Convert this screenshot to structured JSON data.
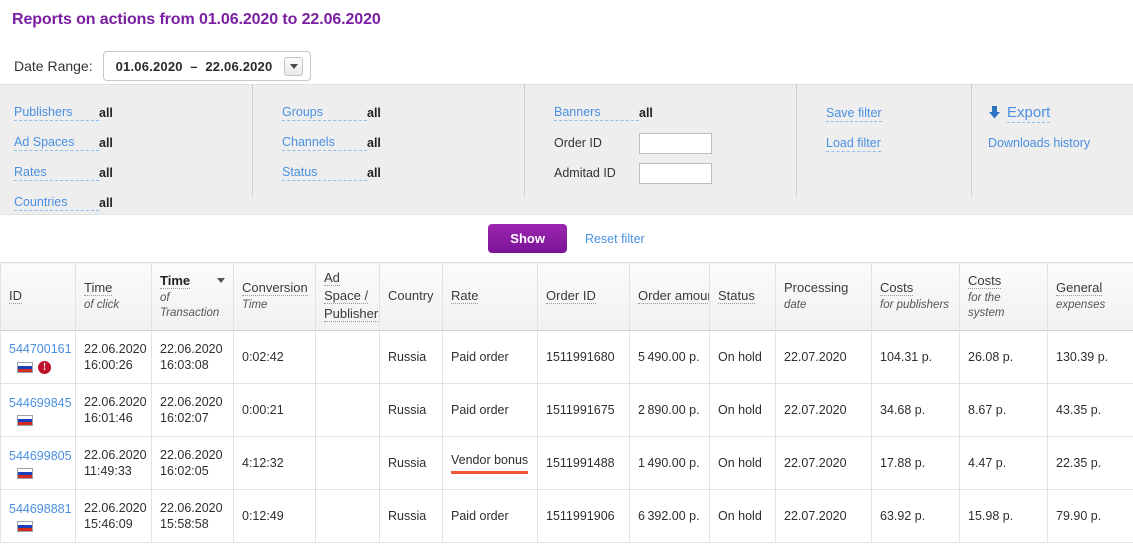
{
  "page": {
    "title": "Reports on actions from 01.06.2020 to 22.06.2020"
  },
  "date_range": {
    "label": "Date Range:",
    "value": "01.06.2020  –  22.06.2020",
    "dropdown_icon": "chevron-down-icon"
  },
  "filters": {
    "col1": [
      {
        "label": "Publishers",
        "value": "all"
      },
      {
        "label": "Ad Spaces",
        "value": "all"
      },
      {
        "label": "Rates",
        "value": "all"
      },
      {
        "label": "Countries",
        "value": "all"
      }
    ],
    "col2": [
      {
        "label": "Groups",
        "value": "all"
      },
      {
        "label": "Channels",
        "value": "all"
      },
      {
        "label": "Status",
        "value": "all"
      }
    ],
    "col3": [
      {
        "label": "Banners",
        "value": "all"
      }
    ],
    "inputs": [
      {
        "label": "Order ID",
        "value": "",
        "placeholder": ""
      },
      {
        "label": "Admitad ID",
        "value": "",
        "placeholder": ""
      }
    ],
    "actions": [
      {
        "label": "Save filter"
      },
      {
        "label": "Load filter"
      }
    ],
    "export": {
      "label": "Export",
      "icon": "download-arrow-icon",
      "history_label": "Downloads history"
    }
  },
  "action_bar": {
    "show_label": "Show",
    "reset_label": "Reset filter"
  },
  "table": {
    "columns": [
      {
        "main": "ID",
        "sub": "",
        "sorted": false,
        "caret": false
      },
      {
        "main": "Time",
        "sub": "of click",
        "sorted": false,
        "caret": false
      },
      {
        "main": "Time",
        "sub": "of Transaction",
        "sorted": true,
        "caret": true
      },
      {
        "main": "Conversion",
        "sub": "Time",
        "sorted": false,
        "caret": false
      },
      {
        "main": "Ad Space / Publisher",
        "sub": "",
        "sorted": false,
        "caret": false
      },
      {
        "main": "Country",
        "sub": "",
        "sorted": false,
        "caret": false
      },
      {
        "main": "Rate",
        "sub": "",
        "sorted": false,
        "caret": false
      },
      {
        "main": "Order ID",
        "sub": "",
        "sorted": false,
        "caret": false
      },
      {
        "main": "Order amount",
        "sub": "",
        "sorted": false,
        "caret": false
      },
      {
        "main": "Status",
        "sub": "",
        "sorted": false,
        "caret": false
      },
      {
        "main": "Processing",
        "sub": "date",
        "sorted": false,
        "caret": false
      },
      {
        "main": "Costs",
        "sub": "for publishers",
        "sorted": false,
        "caret": false
      },
      {
        "main": "Costs",
        "sub": "for the system",
        "sorted": false,
        "caret": false
      },
      {
        "main": "General",
        "sub": "expenses",
        "sorted": false,
        "caret": false
      }
    ],
    "rows": [
      {
        "id": "544700161",
        "flag": "flag-ru-icon",
        "warning": true,
        "warning_glyph": "!",
        "click_date": "22.06.2020",
        "click_time": "16:00:26",
        "trans_date": "22.06.2020",
        "trans_time": "16:03:08",
        "conversion_time": "0:02:42",
        "adspace": "",
        "country": "Russia",
        "rate": "Paid order",
        "rate_highlight": false,
        "order_id": "1511991680",
        "order_amount": "5 490.00 p.",
        "status": "On hold",
        "processing_date": "22.07.2020",
        "costs_publishers": "104.31 p.",
        "costs_system": "26.08 p.",
        "general_expenses": "130.39 p."
      },
      {
        "id": "544699845",
        "flag": "flag-ru-icon",
        "warning": false,
        "warning_glyph": "",
        "click_date": "22.06.2020",
        "click_time": "16:01:46",
        "trans_date": "22.06.2020",
        "trans_time": "16:02:07",
        "conversion_time": "0:00:21",
        "adspace": "",
        "country": "Russia",
        "rate": "Paid order",
        "rate_highlight": false,
        "order_id": "1511991675",
        "order_amount": "2 890.00 p.",
        "status": "On hold",
        "processing_date": "22.07.2020",
        "costs_publishers": "34.68 p.",
        "costs_system": "8.67 p.",
        "general_expenses": "43.35 p."
      },
      {
        "id": "544699805",
        "flag": "flag-ru-icon",
        "warning": false,
        "warning_glyph": "",
        "click_date": "22.06.2020",
        "click_time": "11:49:33",
        "trans_date": "22.06.2020",
        "trans_time": "16:02:05",
        "conversion_time": "4:12:32",
        "adspace": "",
        "country": "Russia",
        "rate": "Vendor bonus",
        "rate_highlight": true,
        "order_id": "1511991488",
        "order_amount": "1 490.00 p.",
        "status": "On hold",
        "processing_date": "22.07.2020",
        "costs_publishers": "17.88 p.",
        "costs_system": "4.47 p.",
        "general_expenses": "22.35 p."
      },
      {
        "id": "544698881",
        "flag": "flag-ru-icon",
        "warning": false,
        "warning_glyph": "",
        "click_date": "22.06.2020",
        "click_time": "15:46:09",
        "trans_date": "22.06.2020",
        "trans_time": "15:58:58",
        "conversion_time": "0:12:49",
        "adspace": "",
        "country": "Russia",
        "rate": "Paid order",
        "rate_highlight": false,
        "order_id": "1511991906",
        "order_amount": "6 392.00 p.",
        "status": "On hold",
        "processing_date": "22.07.2020",
        "costs_publishers": "63.92 p.",
        "costs_system": "15.98 p.",
        "general_expenses": "79.90 p."
      }
    ]
  },
  "colors": {
    "title_purple": "#7b1fa2",
    "link_blue": "#4a90e2",
    "highlight_red": "#f4543c",
    "warning_red": "#c0132a"
  }
}
